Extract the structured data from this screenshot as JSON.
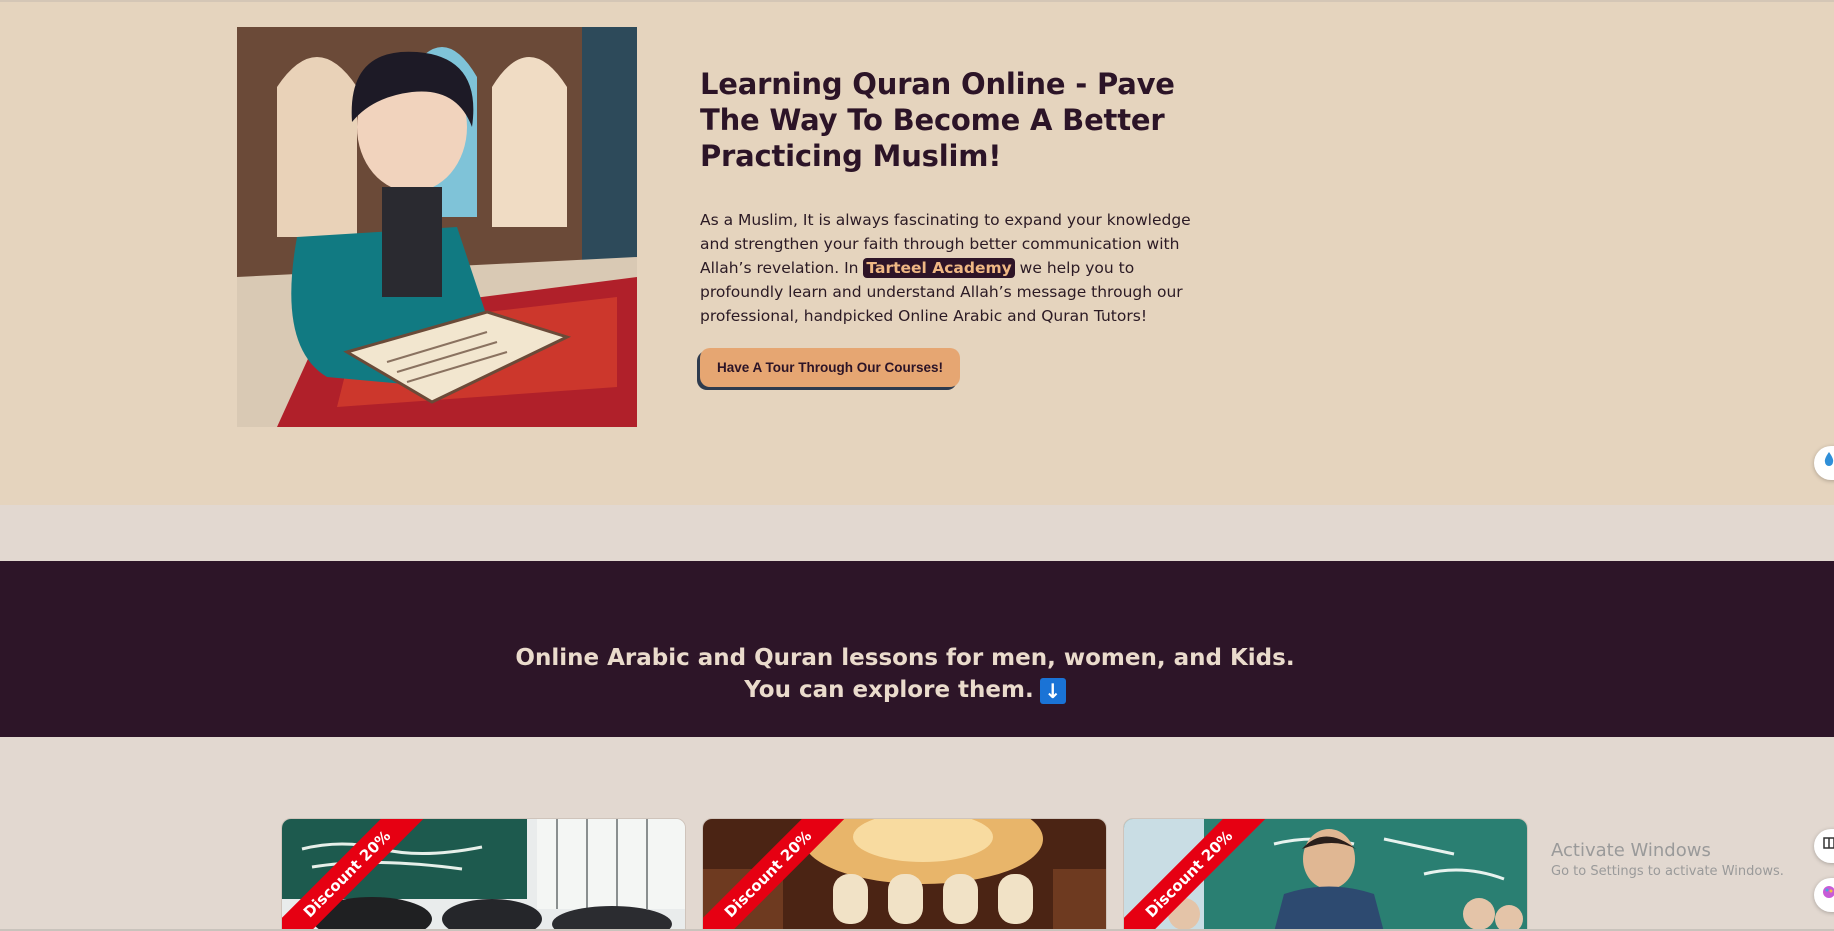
{
  "hero": {
    "title": "Learning Quran Online - Pave The Way To Become A Better Practicing Muslim!",
    "paragraph_before": "As a Muslim, It is always fascinating to expand your knowledge and strengthen your faith through better communication with Allah’s revelation. In ",
    "highlight": "Tarteel Academy",
    "paragraph_after": " we help you to profoundly learn and understand Allah’s message through our professional, handpicked Online Arabic and Quran Tutors!",
    "button_label": "Have A Tour Through Our Courses!"
  },
  "banner": {
    "line1": "Online Arabic and Quran lessons for men, women, and Kids.",
    "line2": "You can explore them.",
    "arrow": "↓"
  },
  "courses": [
    {
      "ribbon": "Discount 20%"
    },
    {
      "ribbon": "Discount 20%"
    },
    {
      "ribbon": "Discount 20%"
    }
  ],
  "windows": {
    "title": "Activate Windows",
    "subtitle": "Go to Settings to activate Windows."
  },
  "colors": {
    "hero_bg": "#e5d4be",
    "banner_bg": "#2d1528",
    "accent": "#e6a672",
    "ribbon": "#e60012"
  }
}
